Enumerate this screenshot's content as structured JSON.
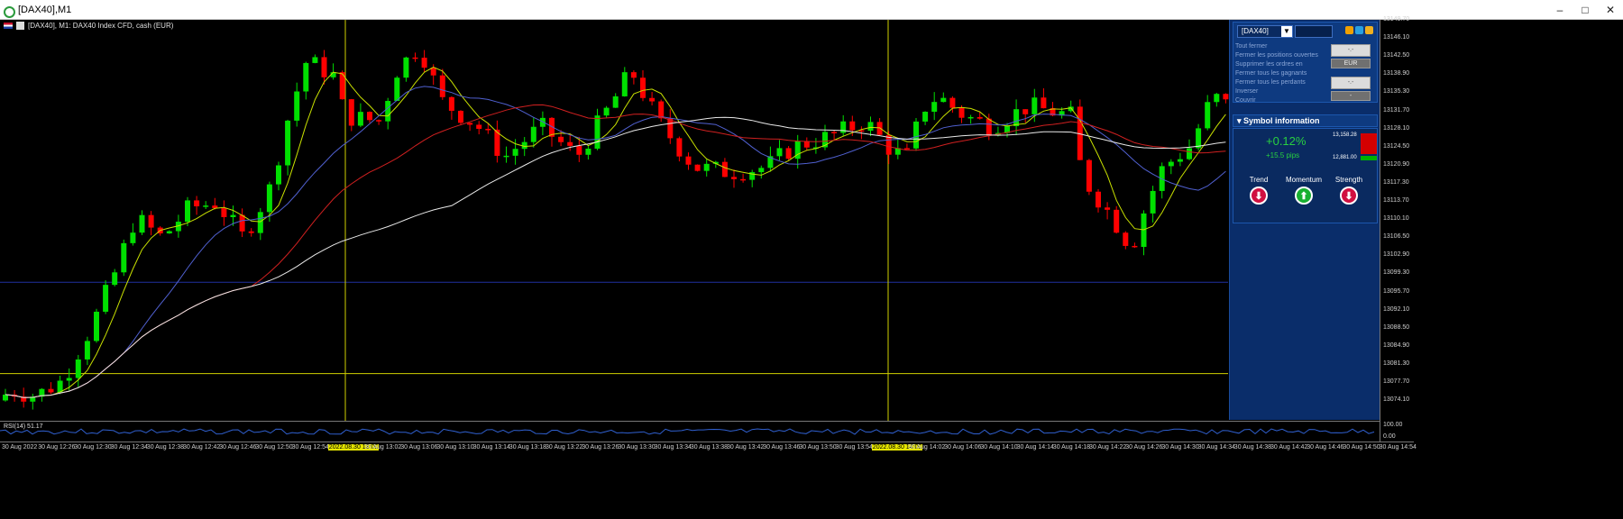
{
  "window": {
    "title": "[DAX40],M1",
    "min_label": "–",
    "max_label": "□",
    "close_label": "✕"
  },
  "chart": {
    "header_text": "[DAX40], M1:  DAX40 Index CFD, cash (EUR)",
    "bg_color": "#000000",
    "bull_color": "#00e000",
    "bear_color": "#ff0000",
    "hline_blue_price": 13099.3,
    "hline_yellow_price": 13081.3
  },
  "price_axis": {
    "labels": [
      "13149.70",
      "13146.10",
      "13142.50",
      "13138.90",
      "13135.30",
      "13131.70",
      "13128.10",
      "13124.50",
      "13120.90",
      "13117.30",
      "13113.70",
      "13110.10",
      "13106.50",
      "13102.90",
      "13099.30",
      "13095.70",
      "13092.10",
      "13088.50",
      "13084.90",
      "13081.30",
      "13077.70",
      "13074.10"
    ]
  },
  "rsi": {
    "label": "RSI(14) 51.17",
    "top_label": "100.00",
    "bottom_label": "0.00"
  },
  "time_axis": {
    "labels": [
      "30 Aug 2022",
      "30 Aug 12:26",
      "30 Aug 12:30",
      "30 Aug 12:34",
      "30 Aug 12:38",
      "30 Aug 12:42",
      "30 Aug 12:46",
      "30 Aug 12:50",
      "30 Aug 12:54",
      "2022.08.30 13:00",
      "30 Aug 13:02",
      "30 Aug 13:06",
      "30 Aug 13:10",
      "30 Aug 13:14",
      "30 Aug 13:18",
      "30 Aug 13:22",
      "30 Aug 13:26",
      "30 Aug 13:30",
      "30 Aug 13:34",
      "30 Aug 13:38",
      "30 Aug 13:42",
      "30 Aug 13:46",
      "30 Aug 13:50",
      "30 Aug 13:54",
      "2022.08.30 14:00",
      "30 Aug 14:02",
      "30 Aug 14:06",
      "30 Aug 14:10",
      "30 Aug 14:14",
      "30 Aug 14:18",
      "30 Aug 14:22",
      "30 Aug 14:26",
      "30 Aug 14:30",
      "30 Aug 14:34",
      "30 Aug 14:38",
      "30 Aug 14:42",
      "30 Aug 14:46",
      "30 Aug 14:50",
      "30 Aug 14:54"
    ],
    "highlighted": [
      "2022.08.30 13:00",
      "2022.08.30 14:00"
    ]
  },
  "trade_panel": {
    "symbol": "[DAX40]",
    "menu": [
      "Tout fermer",
      "Fermer les positions ouvertes",
      "Supprimer les ordres en",
      "Fermer tous les gagnants",
      "Fermer tous les perdants",
      "Inverser",
      "Couvrir"
    ],
    "btn1": "-.-",
    "btn1_sub": "EUR",
    "btn2": "-.-",
    "btn2_sub": "-",
    "section_title": "Symbol information",
    "change_pct": "+0.12%",
    "change_pips": "+15.5 pips",
    "high": "13,158.28",
    "low": "12,881.00",
    "indicators": [
      {
        "name": "Trend",
        "direction": "down"
      },
      {
        "name": "Momentum",
        "direction": "up"
      },
      {
        "name": "Strength",
        "direction": "down"
      }
    ]
  },
  "chart_data": {
    "type": "candlestick",
    "title": "[DAX40], M1:  DAX40 Index CFD, cash (EUR)",
    "ylim": [
      13072,
      13151
    ],
    "rsi_value": 51.17
  }
}
